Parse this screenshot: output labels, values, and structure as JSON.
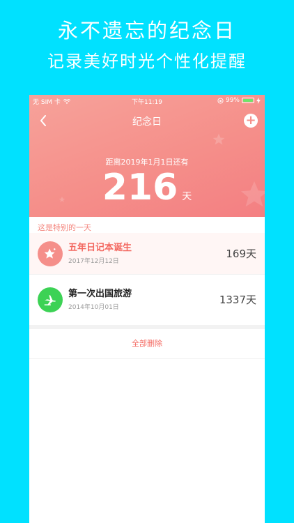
{
  "promo": {
    "title": "永不遗忘的纪念日",
    "subtitle": "记录美好时光个性化提醒"
  },
  "status_bar": {
    "carrier": "无 SIM 卡",
    "time": "下午11:19",
    "battery": "99%"
  },
  "nav": {
    "title": "纪念日",
    "add_label": "+"
  },
  "countdown": {
    "label": "距离2019年1月1日还有",
    "days": "216",
    "unit": "天"
  },
  "list": {
    "section_label": "这是特别的一天",
    "items": [
      {
        "title": "五年日记本诞生",
        "date": "2017年12月12日",
        "days": "169天",
        "icon": "star-icon",
        "color": "#f58f8a"
      },
      {
        "title": "第一次出国旅游",
        "date": "2014年10月01日",
        "days": "1337天",
        "icon": "airplane-icon",
        "color": "#3cd255"
      }
    ]
  },
  "actions": {
    "delete_all": "全部删除"
  },
  "colors": {
    "background": "#00E1FF",
    "hero": "#f58f8a",
    "accent": "#f3675f"
  }
}
